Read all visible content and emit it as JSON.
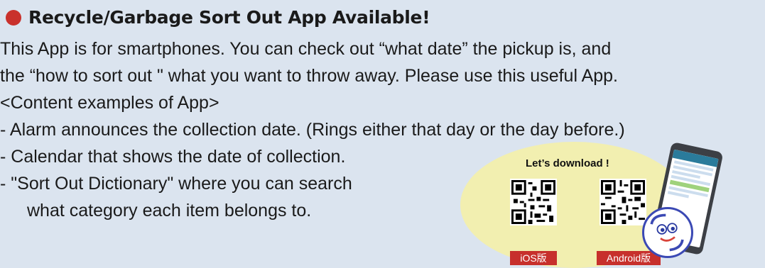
{
  "title": "Recycle/Garbage Sort Out App Available!",
  "body": {
    "lines": [
      "This App is for smartphones. You can check out “what date” the pickup is, and",
      "the “how to sort out \" what you want to  throw away. Please use this useful App.",
      "<Content examples of App>",
      "- Alarm announces the collection date. (Rings either that day or the day before.)",
      "- Calendar that shows the date of collection.",
      "- \"Sort Out Dictionary\" where you can search",
      "what category each item belongs to."
    ]
  },
  "download": {
    "label": "Let’s download !",
    "ios_label": "iOS版",
    "android_label": "Android版"
  },
  "colors": {
    "background": "#dbe4ef",
    "bullet": "#c9312c",
    "ellipse": "#f2efb0",
    "store_label_bg": "#c7302c"
  },
  "icons": [
    "red-bullet-icon",
    "ios-qr-code",
    "android-qr-code",
    "smartphone-app-image",
    "mascot-icon"
  ]
}
